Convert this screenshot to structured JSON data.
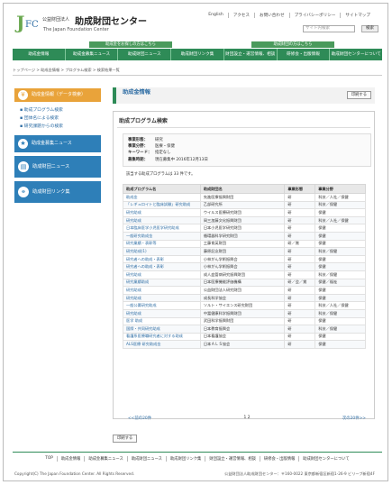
{
  "header": {
    "org_small": "公益財団法人",
    "org_big": "助成財団センター",
    "org_en": "The Japan Foundation Center",
    "top_links": [
      "English",
      "アクセス",
      "お問い合わせ",
      "プライバシーポリシー",
      "サイトマップ"
    ],
    "search_placeholder": "サイト内検索",
    "search_button": "検索",
    "subbar_left": "助成金をお探しの方はこちら",
    "subbar_right": "助成財団の方はこちら"
  },
  "nav": [
    "助成金情報",
    "助成金募集ニュース",
    "助成財団ニュース",
    "助成財団リンク集",
    "財団設立・運営情報、相談",
    "研修会・出版情報",
    "助成財団センターについて"
  ],
  "breadcrumb": "トップページ > 助成金情報 > プログラム検索 > 検索結果一覧",
  "sidebar": {
    "active": "助成金情報（データ検索）",
    "sub_links": [
      "助成プログラム検索",
      "団体名による検索",
      "研究課題からの検索"
    ],
    "blocks": [
      "助成金募集ニュース",
      "助成財団ニュース",
      "助成財団リンク集"
    ]
  },
  "main": {
    "title": "助成金情報",
    "print_label": "印刷する",
    "panel_title": "助成プログラム検索",
    "conditions": [
      {
        "label": "事業形態：",
        "value": "研究"
      },
      {
        "label": "事業分野：",
        "value": "医療・保健"
      },
      {
        "label": "キーワード：",
        "value": "指定なし"
      },
      {
        "label": "募集時期：",
        "value": "現在募集中 2016年12月13日"
      }
    ],
    "count_text": "該当する助成プログラムは 33 件です。",
    "columns": [
      "助成プログラム名",
      "助成財団名",
      "事業形態",
      "事業分野"
    ],
    "rows": [
      [
        "助成金",
        "先進医療振興財団",
        "研",
        "科技／人社／保健"
      ],
      [
        "「レギュロイトと臨床試験」研究助成",
        "乙部研究所",
        "研",
        "科技／保健"
      ],
      [
        "研究助成",
        "ウイルス医療研究財団",
        "研",
        "保健"
      ],
      [
        "研究助成",
        "岡三加藤文化振興財団",
        "研",
        "科技／人社／保健"
      ],
      [
        "日本臨床医学小児医学研究助成",
        "日本小児医学研究財団",
        "研",
        "保健"
      ],
      [
        "一般研究助成金",
        "循環器科学研究財団",
        "研",
        "保健"
      ],
      [
        "研究業績・表彰等",
        "工藤育英財団",
        "研／賞",
        "保健"
      ],
      [
        "研究助成(1)",
        "藤原記念財団",
        "研",
        "科技／保健"
      ],
      [
        "研究者への助成・表彰",
        "小林がん学術振興会",
        "研",
        "保健"
      ],
      [
        "研究者への助成・表彰",
        "小林がん学術振興会",
        "研",
        "保健"
      ],
      [
        "研究助成",
        "成人血管病研究振興財団",
        "研",
        "科技／保健"
      ],
      [
        "研究業績助成",
        "日本医療機能評価機構",
        "研／会／賞",
        "保健／福祉"
      ],
      [
        "研究助成",
        "公益財団法人研究財団",
        "研",
        "保健"
      ],
      [
        "研究助成",
        "成長科学協会",
        "研",
        "保健"
      ],
      [
        "一般公募研究助成",
        "ソルト・サイエンス研究財団",
        "研",
        "科技／人社／保健"
      ],
      [
        "研究助成",
        "中冨健康科学振興財団",
        "研",
        "科技／保健"
      ],
      [
        "医学 助成",
        "武田科学振興財団",
        "研",
        "保健"
      ],
      [
        "国際・共同研究助成",
        "日本教育振興会",
        "研",
        "科技／保健"
      ],
      [
        "看護系医療職研究者に対する助成",
        "日本看護協会",
        "研",
        "保健"
      ],
      [
        "ALS医療 研究助成金",
        "日本ＡＬＳ協会",
        "研",
        "保健"
      ]
    ],
    "pager_prev": "<<前の20件",
    "pager_pages": "1 2",
    "pager_next": "次の20件>>"
  },
  "footer": {
    "links": [
      "TOP",
      "助成金情報",
      "助成金募集ニュース",
      "助成財団ニュース",
      "助成財団リンク集",
      "財団設立・運営情報、相談",
      "研修会・出版情報",
      "助成財団センターについて"
    ],
    "copyright": "Copyright(C) The Japan Foundation Center. All Rights Reserved.",
    "address": "公益財団法人助成財団センター：〒160-0022 東京都新宿区新宿1-26-9 ビリーブ新宿4F"
  }
}
